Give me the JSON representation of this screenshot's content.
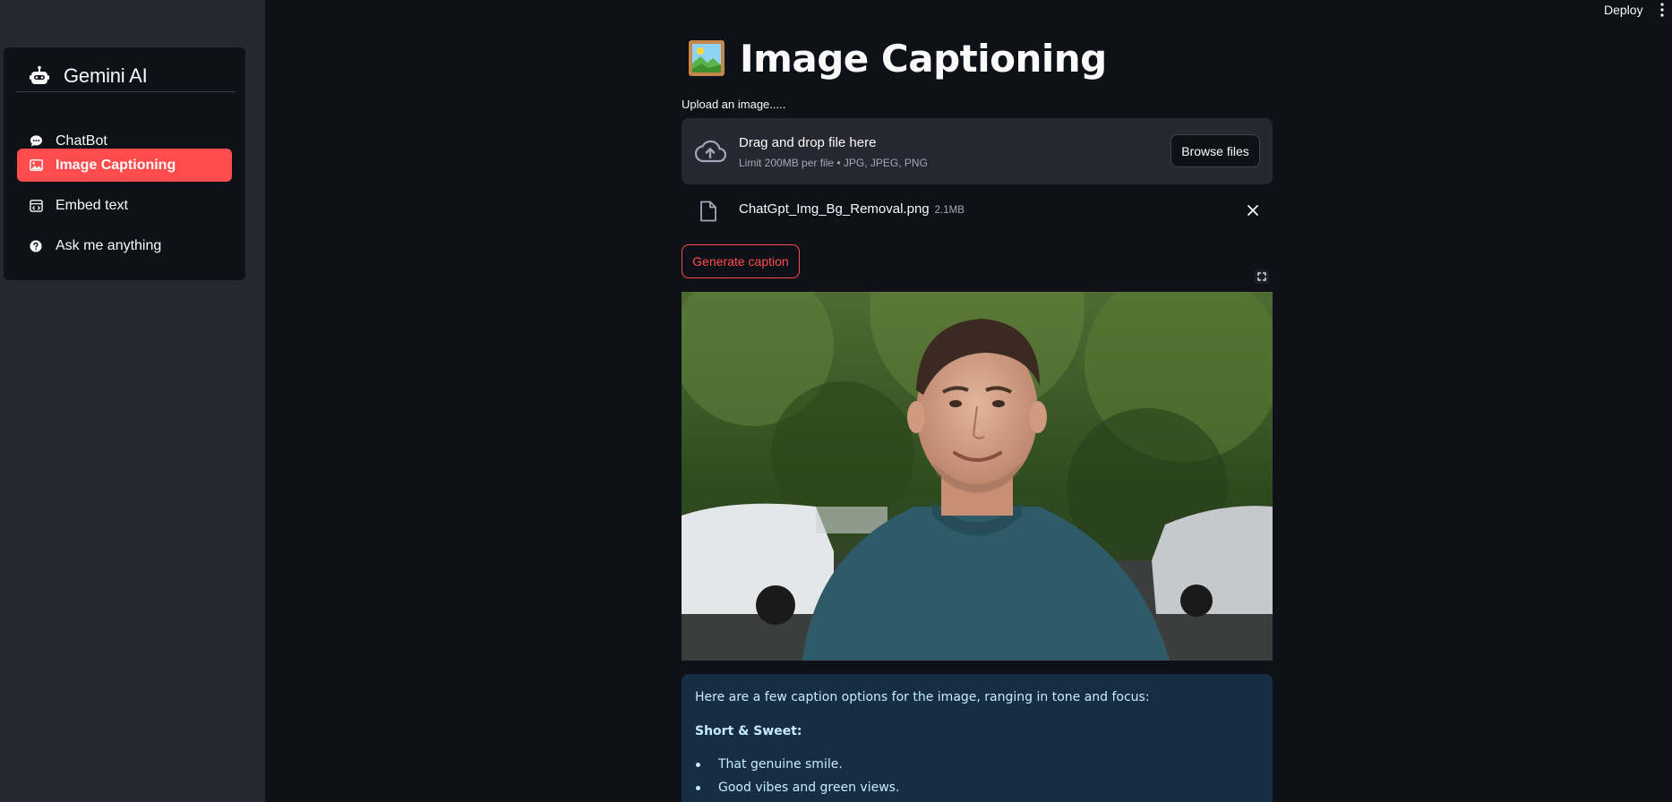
{
  "sidebar": {
    "brand": "Gemini AI",
    "items": [
      {
        "label": "ChatBot",
        "icon": "chat-bubble-icon",
        "active": false
      },
      {
        "label": "Image Captioning",
        "icon": "image-icon",
        "active": true
      },
      {
        "label": "Embed text",
        "icon": "embed-icon",
        "active": false
      },
      {
        "label": "Ask me anything",
        "icon": "question-icon",
        "active": false
      }
    ]
  },
  "topbar": {
    "deploy_label": "Deploy"
  },
  "main": {
    "title": "Image Captioning",
    "upload_label": "Upload an image.....",
    "dropzone": {
      "title": "Drag and drop file here",
      "subtitle": "Limit 200MB per file • JPG, JPEG, PNG",
      "browse_label": "Browse files"
    },
    "file": {
      "name": "ChatGpt_Img_Bg_Removal.png",
      "size": "2.1MB"
    },
    "generate_label": "Generate caption",
    "caption": {
      "intro": "Here are a few caption options for the image, ranging in tone and focus:",
      "section_title": "Short & Sweet:",
      "bullets": [
        "That genuine smile.",
        "Good vibes and green views."
      ]
    }
  },
  "colors": {
    "accent": "#ff4b4b",
    "background": "#0e1117",
    "sidebar": "#262730",
    "caption_bg": "#172d43",
    "caption_text": "#c7ebff"
  }
}
